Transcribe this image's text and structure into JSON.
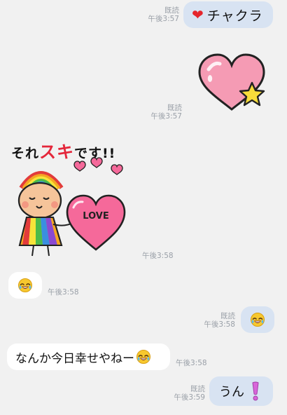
{
  "messages": {
    "m1": {
      "heart": "❤",
      "text": "チャクラ",
      "read": "既読",
      "time": "午後3:57"
    },
    "m2": {
      "read": "既読",
      "time": "午後3:57"
    },
    "m3": {
      "caption": "それスキです!!",
      "caption_normal_1": "それ",
      "caption_red": "スキ",
      "caption_normal_2": "です!!",
      "love": "LOVE",
      "time": "午後3:58"
    },
    "m4": {
      "emoji": "laughing-with-tears",
      "time": "午後3:58"
    },
    "m5": {
      "emoji": "laughing-with-tears",
      "read": "既読",
      "time": "午後3:58"
    },
    "m6": {
      "text": "なんか今日幸せやねー",
      "emoji": "laughing-with-tears",
      "time": "午後3:58"
    },
    "m7": {
      "text": "うん",
      "emoji": "exclamation-mark",
      "read": "既読",
      "time": "午後3:59"
    }
  },
  "colors": {
    "background": "#f1f1f1",
    "outgoing_bubble": "#d8e3f2",
    "incoming_bubble": "#ffffff",
    "meta_text": "#9aa0a8",
    "heart_red": "#e5252c",
    "sticker_pink": "#f59bb4",
    "sticker_star": "#f7dc3a"
  }
}
